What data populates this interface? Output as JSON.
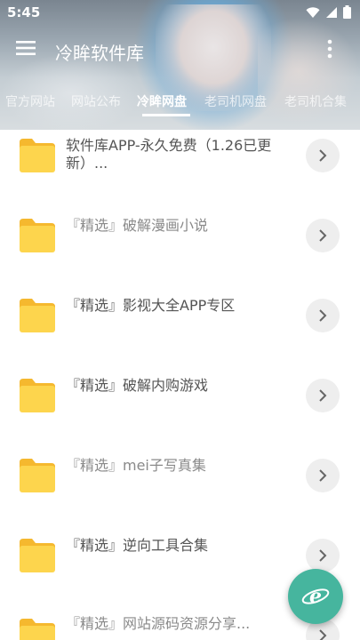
{
  "status_bar": {
    "time": "5:45"
  },
  "toolbar": {
    "title": "冷眸软件库"
  },
  "tabs": [
    {
      "label": "官方网站",
      "active": false
    },
    {
      "label": "网站公布",
      "active": false
    },
    {
      "label": "冷眸网盘",
      "active": true
    },
    {
      "label": "老司机网盘",
      "active": false
    },
    {
      "label": "老司机合集",
      "active": false
    }
  ],
  "items": [
    {
      "title": "软件库APP-永久免费（1.26已更新）..."
    },
    {
      "title": "『精选』破解漫画小说"
    },
    {
      "title": "『精选』影视大全APP专区"
    },
    {
      "title": "『精选』破解内购游戏"
    },
    {
      "title": "『精选』mei子写真集"
    },
    {
      "title": "『精选』逆向工具合集"
    },
    {
      "title": "『精选』网站源码资源分享..."
    }
  ],
  "colors": {
    "accent": "#46b59e",
    "folder": "#fdd54d",
    "folder_tab": "#f5b82e"
  },
  "icons": {
    "menu": "hamburger-menu-icon",
    "more": "more-vert-icon",
    "folder": "folder-icon",
    "chevron": "chevron-right-icon",
    "fab": "browser-e-icon"
  }
}
